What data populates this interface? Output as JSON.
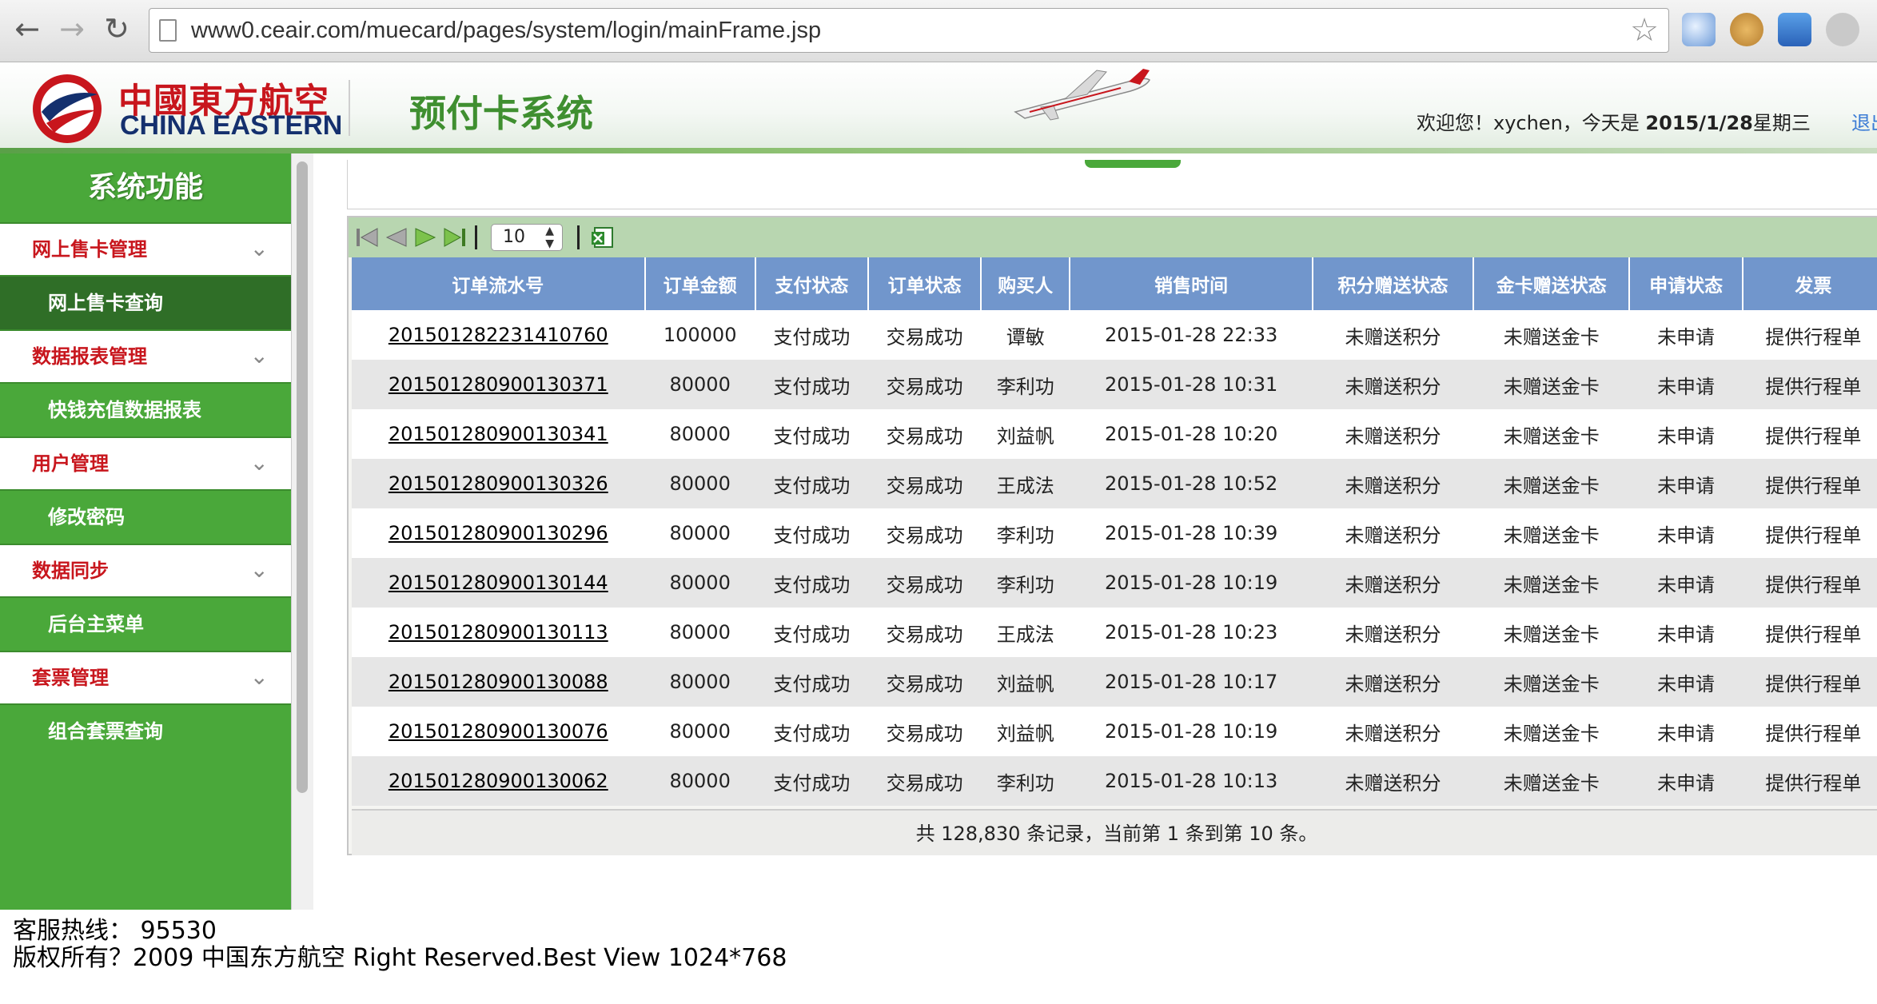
{
  "browser": {
    "url": "www0.ceair.com/muecard/pages/system/login/mainFrame.jsp",
    "back_icon": "arrow-left-icon",
    "forward_icon": "arrow-right-icon",
    "reload_icon": "reload-icon"
  },
  "header": {
    "logo_cn": "中國東方航空",
    "logo_en": "CHINA EASTERN",
    "system_title": "预付卡系统",
    "welcome_prefix": "欢迎您！xychen，今天是 ",
    "welcome_date": "2015/1/28",
    "welcome_weekday": "星期三",
    "logout_label": "退出"
  },
  "sidebar": {
    "title": "系统功能",
    "groups": [
      {
        "label": "网上售卡管理",
        "items": [
          "网上售卡查询"
        ]
      },
      {
        "label": "数据报表管理",
        "items": [
          "快钱充值数据报表"
        ]
      },
      {
        "label": "用户管理",
        "items": [
          "修改密码"
        ]
      },
      {
        "label": "数据同步",
        "items": [
          "后台主菜单"
        ]
      },
      {
        "label": "套票管理",
        "items": [
          "组合套票查询"
        ]
      }
    ]
  },
  "pager": {
    "page_size": "10"
  },
  "table": {
    "columns": [
      "订单流水号",
      "订单金额",
      "支付状态",
      "订单状态",
      "购买人",
      "销售时间",
      "积分赠送状态",
      "金卡赠送状态",
      "申请状态",
      "发票"
    ],
    "rows": [
      [
        "201501282231410760",
        "100000",
        "支付成功",
        "交易成功",
        "谭敏",
        "2015-01-28 22:33",
        "未赠送积分",
        "未赠送金卡",
        "未申请",
        "提供行程单"
      ],
      [
        "201501280900130371",
        "80000",
        "支付成功",
        "交易成功",
        "李利功",
        "2015-01-28 10:31",
        "未赠送积分",
        "未赠送金卡",
        "未申请",
        "提供行程单"
      ],
      [
        "201501280900130341",
        "80000",
        "支付成功",
        "交易成功",
        "刘益帆",
        "2015-01-28 10:20",
        "未赠送积分",
        "未赠送金卡",
        "未申请",
        "提供行程单"
      ],
      [
        "201501280900130326",
        "80000",
        "支付成功",
        "交易成功",
        "王成法",
        "2015-01-28 10:52",
        "未赠送积分",
        "未赠送金卡",
        "未申请",
        "提供行程单"
      ],
      [
        "201501280900130296",
        "80000",
        "支付成功",
        "交易成功",
        "李利功",
        "2015-01-28 10:39",
        "未赠送积分",
        "未赠送金卡",
        "未申请",
        "提供行程单"
      ],
      [
        "201501280900130144",
        "80000",
        "支付成功",
        "交易成功",
        "李利功",
        "2015-01-28 10:19",
        "未赠送积分",
        "未赠送金卡",
        "未申请",
        "提供行程单"
      ],
      [
        "201501280900130113",
        "80000",
        "支付成功",
        "交易成功",
        "王成法",
        "2015-01-28 10:23",
        "未赠送积分",
        "未赠送金卡",
        "未申请",
        "提供行程单"
      ],
      [
        "201501280900130088",
        "80000",
        "支付成功",
        "交易成功",
        "刘益帆",
        "2015-01-28 10:17",
        "未赠送积分",
        "未赠送金卡",
        "未申请",
        "提供行程单"
      ],
      [
        "201501280900130076",
        "80000",
        "支付成功",
        "交易成功",
        "刘益帆",
        "2015-01-28 10:19",
        "未赠送积分",
        "未赠送金卡",
        "未申请",
        "提供行程单"
      ],
      [
        "201501280900130062",
        "80000",
        "支付成功",
        "交易成功",
        "李利功",
        "2015-01-28 10:13",
        "未赠送积分",
        "未赠送金卡",
        "未申请",
        "提供行程单"
      ]
    ],
    "summary": "共 128,830 条记录，当前第 1 条到第 10 条。"
  },
  "footer": {
    "hotline": "客服热线：  95530",
    "copyright": "版权所有？2009 中国东方航空 Right Reserved.Best View 1024*768"
  },
  "colors": {
    "sidebar_green": "#4aa83a",
    "header_blue": "#7196cc",
    "brand_red": "#c8161d",
    "brand_navy": "#14306e"
  }
}
